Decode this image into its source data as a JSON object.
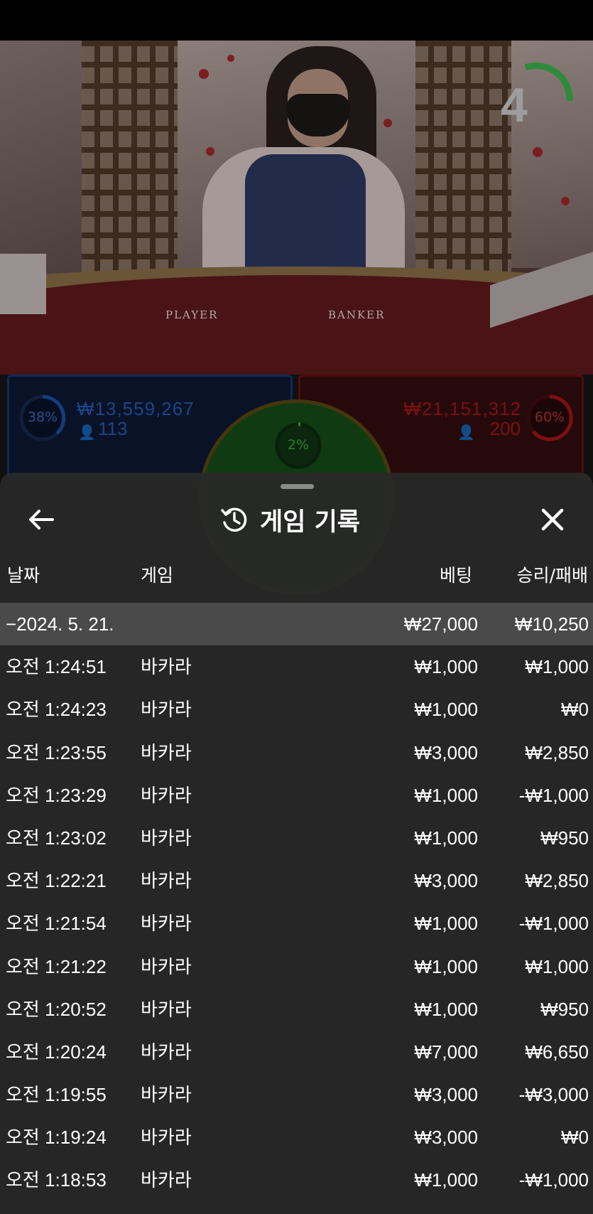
{
  "video": {
    "countdown": "4",
    "table_labels": {
      "player": "PLAYER",
      "banker": "BANKER"
    }
  },
  "bets": {
    "player": {
      "percent": "38%",
      "amount": "₩13,559,267",
      "count": "113",
      "color": "#1f5fbf"
    },
    "tie": {
      "percent": "2%"
    },
    "banker": {
      "percent": "60%",
      "amount": "₩21,151,312",
      "count": "200",
      "color": "#c0191d"
    }
  },
  "history": {
    "title": "게임 기록",
    "columns": {
      "date": "날짜",
      "game": "게임",
      "bet": "베팅",
      "result": "승리/패배"
    },
    "summary": {
      "date": "−2024. 5. 21.",
      "bet": "₩27,000",
      "result": "₩10,250"
    },
    "rows": [
      {
        "time": "오전 1:24:51",
        "game": "바카라",
        "bet": "₩1,000",
        "result": "₩1,000"
      },
      {
        "time": "오전 1:24:23",
        "game": "바카라",
        "bet": "₩1,000",
        "result": "₩0"
      },
      {
        "time": "오전 1:23:55",
        "game": "바카라",
        "bet": "₩3,000",
        "result": "₩2,850"
      },
      {
        "time": "오전 1:23:29",
        "game": "바카라",
        "bet": "₩1,000",
        "result": "-₩1,000"
      },
      {
        "time": "오전 1:23:02",
        "game": "바카라",
        "bet": "₩1,000",
        "result": "₩950"
      },
      {
        "time": "오전 1:22:21",
        "game": "바카라",
        "bet": "₩3,000",
        "result": "₩2,850"
      },
      {
        "time": "오전 1:21:54",
        "game": "바카라",
        "bet": "₩1,000",
        "result": "-₩1,000"
      },
      {
        "time": "오전 1:21:22",
        "game": "바카라",
        "bet": "₩1,000",
        "result": "₩1,000"
      },
      {
        "time": "오전 1:20:52",
        "game": "바카라",
        "bet": "₩1,000",
        "result": "₩950"
      },
      {
        "time": "오전 1:20:24",
        "game": "바카라",
        "bet": "₩7,000",
        "result": "₩6,650"
      },
      {
        "time": "오전 1:19:55",
        "game": "바카라",
        "bet": "₩3,000",
        "result": "-₩3,000"
      },
      {
        "time": "오전 1:19:24",
        "game": "바카라",
        "bet": "₩3,000",
        "result": "₩0"
      },
      {
        "time": "오전 1:18:53",
        "game": "바카라",
        "bet": "₩1,000",
        "result": "-₩1,000"
      }
    ],
    "icons": {
      "back": "arrow-left-icon",
      "history": "history-clock-icon",
      "close": "close-icon"
    }
  }
}
